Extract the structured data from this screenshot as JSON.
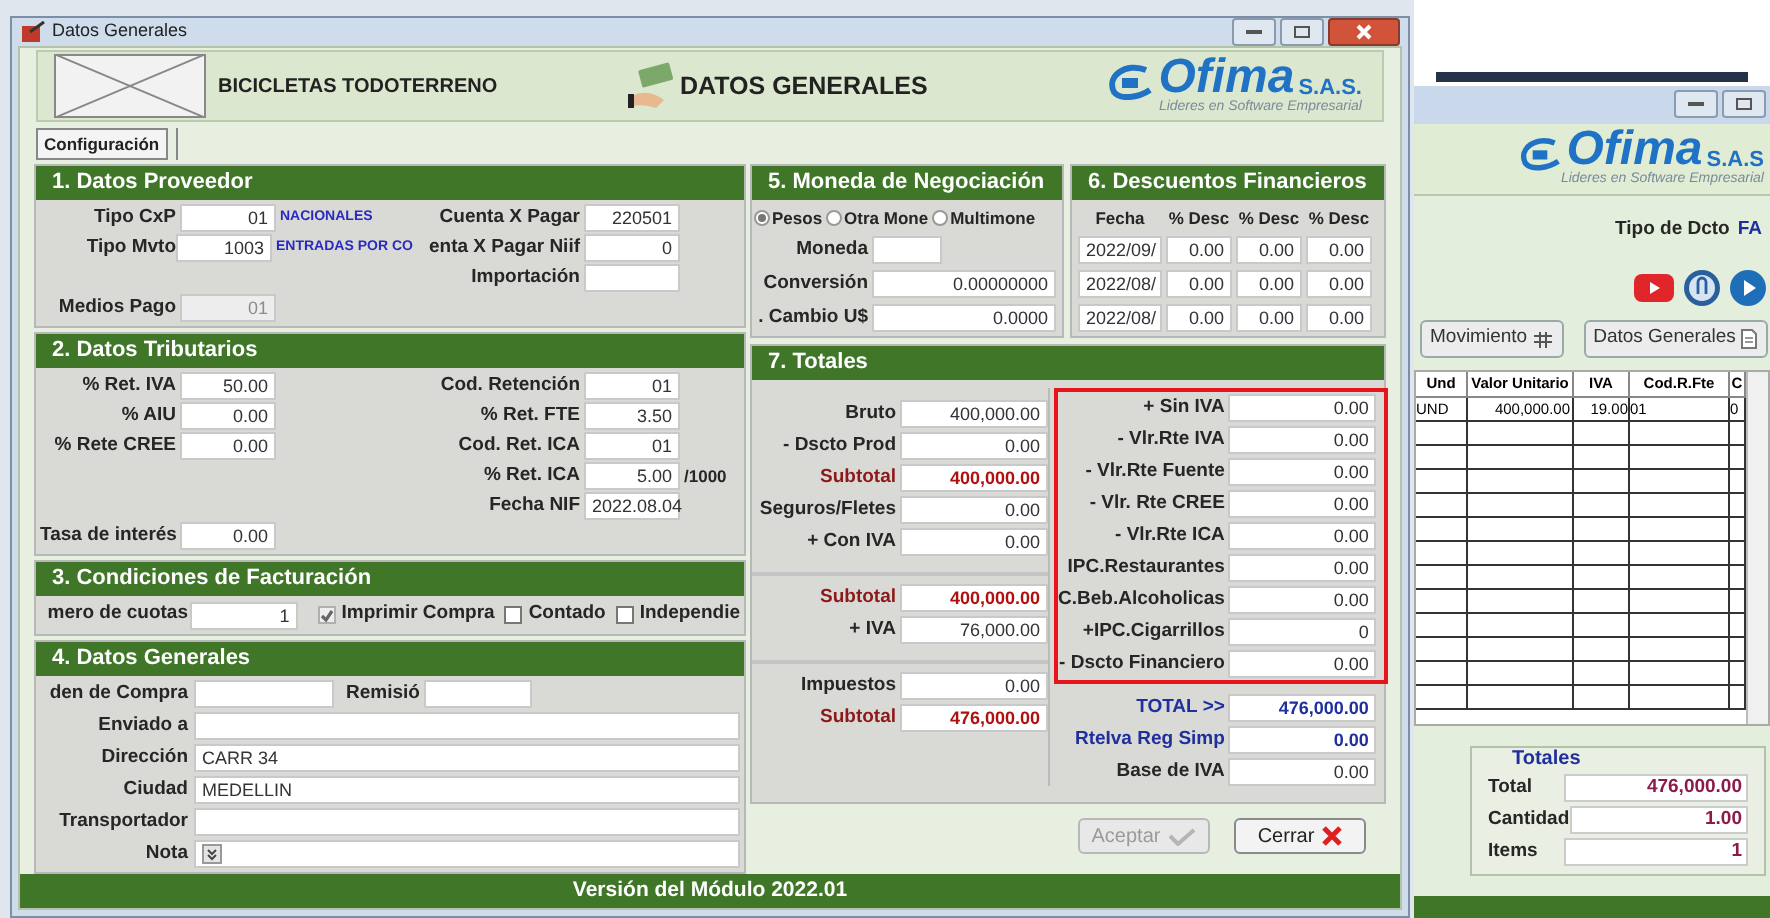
{
  "dialog": {
    "title": "Datos Generales",
    "company": "BICICLETAS TODOTERRENO",
    "heading": "DATOS GENERALES",
    "logo": {
      "name": "Ofima",
      "suffix": "S.A.S.",
      "tagline": "Lideres en Software Empresarial"
    },
    "tabs": [
      {
        "label": "Configuración",
        "selected": true
      }
    ],
    "proveedor": {
      "title": "1. Datos Proveedor",
      "rows": [
        {
          "left": {
            "label": "Tipo CxP",
            "value": "01",
            "note": "NACIONALES"
          },
          "right": {
            "label": "Cuenta X Pagar",
            "value": "220501"
          }
        },
        {
          "left": {
            "label": "Tipo Mvto",
            "value": "1003",
            "note": "ENTRADAS POR CO"
          },
          "right": {
            "label": "enta X Pagar Niif",
            "value": "0"
          }
        },
        {
          "right": {
            "label": "Importación"
          }
        },
        {
          "left": {
            "label": "Medios Pago",
            "value": "01",
            "disabled": true
          }
        }
      ]
    },
    "tributarios": {
      "title": "2. Datos Tributarios",
      "rows": [
        {
          "left": {
            "label": "% Ret. IVA",
            "value": "50.00"
          },
          "right": {
            "label": "Cod. Retención",
            "value": "01"
          }
        },
        {
          "left": {
            "label": "% AIU",
            "value": "0.00"
          },
          "right": {
            "label": "% Ret. FTE",
            "value": "3.50"
          }
        },
        {
          "left": {
            "label": "% Rete CREE",
            "value": "0.00"
          },
          "right": {
            "label": "Cod. Ret. ICA",
            "value": "01"
          }
        },
        {
          "right": {
            "label": "% Ret. ICA",
            "value": "5.00",
            "suffix": "/1000"
          }
        },
        {
          "right": {
            "label": "Fecha NIF",
            "value": "2022.08.04"
          }
        },
        {
          "left": {
            "label": "Tasa de interés",
            "value": "0.00"
          }
        }
      ]
    },
    "facturacion": {
      "title": "3. Condiciones de Facturación",
      "cuotas": {
        "label": "mero de cuotas",
        "value": "1"
      },
      "checks": [
        {
          "label": "Imprimir Compra",
          "checked": true,
          "disabled": true
        },
        {
          "label": "Contado",
          "checked": false,
          "disabled": false
        },
        {
          "label": "Independie",
          "checked": false,
          "disabled": false
        }
      ]
    },
    "generales": {
      "title": "4. Datos Generales",
      "orden": {
        "label": "den de Compra"
      },
      "remision": {
        "label": "Remisió"
      },
      "fields": [
        {
          "label": "Enviado a",
          "kind": "text"
        },
        {
          "label": "Dirección",
          "value": "CARR 34",
          "kind": "text"
        },
        {
          "label": "Ciudad",
          "value": "MEDELLIN",
          "kind": "text"
        },
        {
          "label": "Transportador",
          "kind": "text"
        },
        {
          "label": "Nota",
          "kind": "dropdown"
        }
      ]
    },
    "moneda": {
      "title": "5. Moneda de Negociación",
      "options": [
        {
          "label": "Pesos",
          "selected": true
        },
        {
          "label": "Otra Mone",
          "selected": false
        },
        {
          "label": "Multimone",
          "selected": false
        }
      ],
      "fields": [
        {
          "label": "Moneda"
        },
        {
          "label": "Conversión",
          "value": "0.00000000"
        },
        {
          "label": ". Cambio U$",
          "value": "0.0000"
        }
      ]
    },
    "descuentos": {
      "title": "6. Descuentos Financieros",
      "columns": [
        "Fecha",
        "% Desc",
        "% Desc",
        "% Desc"
      ],
      "rows": [
        [
          "2022/09/",
          "0.00",
          "0.00",
          "0.00"
        ],
        [
          "2022/08/",
          "0.00",
          "0.00",
          "0.00"
        ],
        [
          "2022/08/",
          "0.00",
          "0.00",
          "0.00"
        ]
      ]
    },
    "totales": {
      "title": "7. Totales",
      "left_groups": [
        [
          {
            "label": "Bruto",
            "value": "400,000.00",
            "kind": "plain"
          },
          {
            "label": "- Dscto Prod",
            "value": "0.00",
            "kind": "plain"
          },
          {
            "label": "Subtotal",
            "value": "400,000.00",
            "kind": "subtotal"
          },
          {
            "label": "Seguros/Fletes",
            "value": "0.00",
            "kind": "plain"
          },
          {
            "label": "+ Con IVA",
            "value": "0.00",
            "kind": "plain"
          }
        ],
        [
          {
            "label": "Subtotal",
            "value": "400,000.00",
            "kind": "subtotal"
          },
          {
            "label": "+ IVA",
            "value": "76,000.00",
            "kind": "plain"
          }
        ],
        [
          {
            "label": "Impuestos",
            "value": "0.00",
            "kind": "plain"
          },
          {
            "label": "Subtotal",
            "value": "476,000.00",
            "kind": "subtotal"
          }
        ]
      ],
      "marked": [
        {
          "label": "+ Sin IVA",
          "value": "0.00",
          "kind": "plain"
        },
        {
          "label": "- Vlr.Rte IVA",
          "value": "0.00",
          "kind": "plain"
        },
        {
          "label": "- Vlr.Rte Fuente",
          "value": "0.00",
          "kind": "plain"
        },
        {
          "label": "- Vlr. Rte CREE",
          "value": "0.00",
          "kind": "plain"
        },
        {
          "label": "- Vlr.Rte ICA",
          "value": "0.00",
          "kind": "plain"
        },
        {
          "label": "IPC.Restaurantes",
          "value": "0.00",
          "kind": "plain"
        },
        {
          "label": "C.Beb.Alcoholicas",
          "value": "0.00",
          "kind": "plain"
        },
        {
          "label": "+IPC.Cigarrillos",
          "value": "0",
          "kind": "plain"
        },
        {
          "label": "- Dscto Financiero",
          "value": "0.00",
          "kind": "plain"
        }
      ],
      "right": [
        {
          "label": "TOTAL  >>",
          "value": "476,000.00",
          "kind": "total"
        },
        {
          "label": "RteIva Reg Simp",
          "value": "0.00",
          "kind": "total"
        },
        {
          "label": "Base de IVA",
          "value": "0.00",
          "kind": "plain"
        }
      ]
    },
    "buttons": [
      {
        "label": "Aceptar",
        "disabled": true,
        "kind": "accept"
      },
      {
        "label": "Cerrar",
        "disabled": false,
        "kind": "close"
      }
    ],
    "footer": "Versión del Módulo 2022.01"
  },
  "background_window": {
    "logo": {
      "name": "Ofima",
      "suffix": "S.A.S",
      "tagline": "Lideres en Software Empresarial"
    },
    "doc_type": {
      "label": "Tipo de Dcto",
      "value": "FA"
    },
    "buttons": [
      {
        "label": "Movimiento",
        "kind": "grid"
      },
      {
        "label": "Datos Generales",
        "kind": "document"
      }
    ],
    "table": {
      "columns": [
        "Und",
        "Valor Unitario",
        "IVA",
        "Cod.R.Fte",
        "C"
      ],
      "rows": [
        [
          "UND",
          "400,000.00",
          "19.00",
          "01",
          "0"
        ]
      ]
    },
    "totals": {
      "title": "Totales",
      "rows": [
        {
          "label": "Total",
          "value": "476,000.00"
        },
        {
          "label": "Cantidad",
          "value": "1.00"
        },
        {
          "label": "Items",
          "value": "1"
        }
      ]
    }
  }
}
